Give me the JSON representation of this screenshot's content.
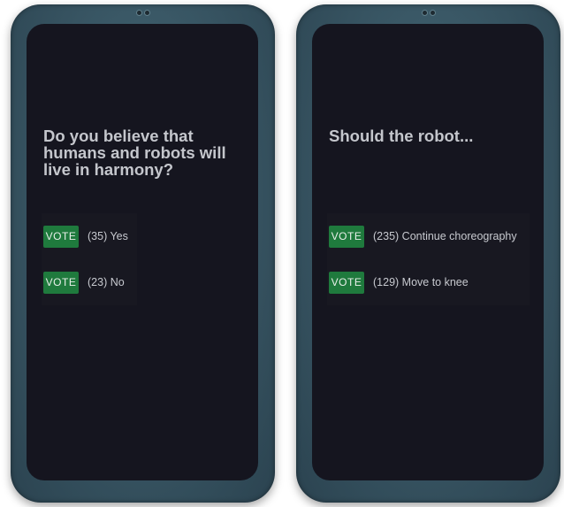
{
  "polls": [
    {
      "question": "Do you believe that humans and robots will live in harmony?",
      "options": [
        {
          "vote_label": "VOTE",
          "count": "(35)",
          "answer": "Yes"
        },
        {
          "vote_label": "VOTE",
          "count": "(23)",
          "answer": "No"
        }
      ]
    },
    {
      "question": "Should the robot...",
      "options": [
        {
          "vote_label": "VOTE",
          "count": "(235)",
          "answer": "Continue choreography"
        },
        {
          "vote_label": "VOTE",
          "count": "(129)",
          "answer": "Move to knee"
        }
      ]
    }
  ],
  "colors": {
    "phone_frame": "#3a5866",
    "screen_bg": "#15151f",
    "vote_button": "#1f7a3d",
    "text": "#c4c6cc"
  }
}
